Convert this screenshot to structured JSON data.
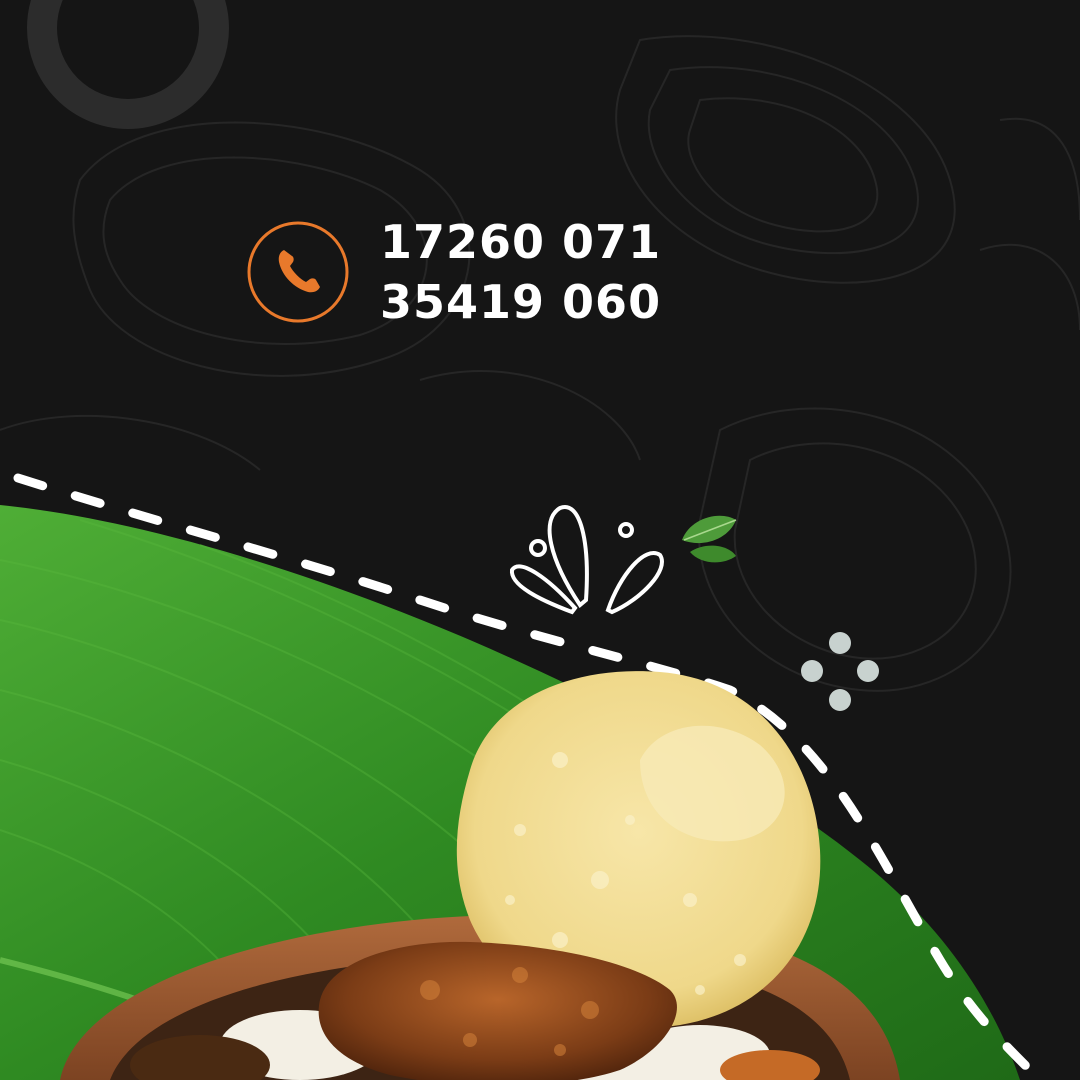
{
  "contact": {
    "phone_icon": "phone-icon",
    "numbers": [
      "17260 071",
      "35419 060"
    ]
  },
  "colors": {
    "background": "#151515",
    "accent": "#e8792b",
    "text": "#ffffff",
    "leaf": "#3f9a2c",
    "papad": "#f0dc94",
    "bowl": "#9a5a34"
  },
  "illustration": {
    "items": [
      "banana-leaf",
      "papad",
      "clay-bowl",
      "fried-fish",
      "rice",
      "basil-leaves",
      "splash-doodle",
      "dotted-path",
      "dots-cluster",
      "ring-decoration"
    ]
  }
}
